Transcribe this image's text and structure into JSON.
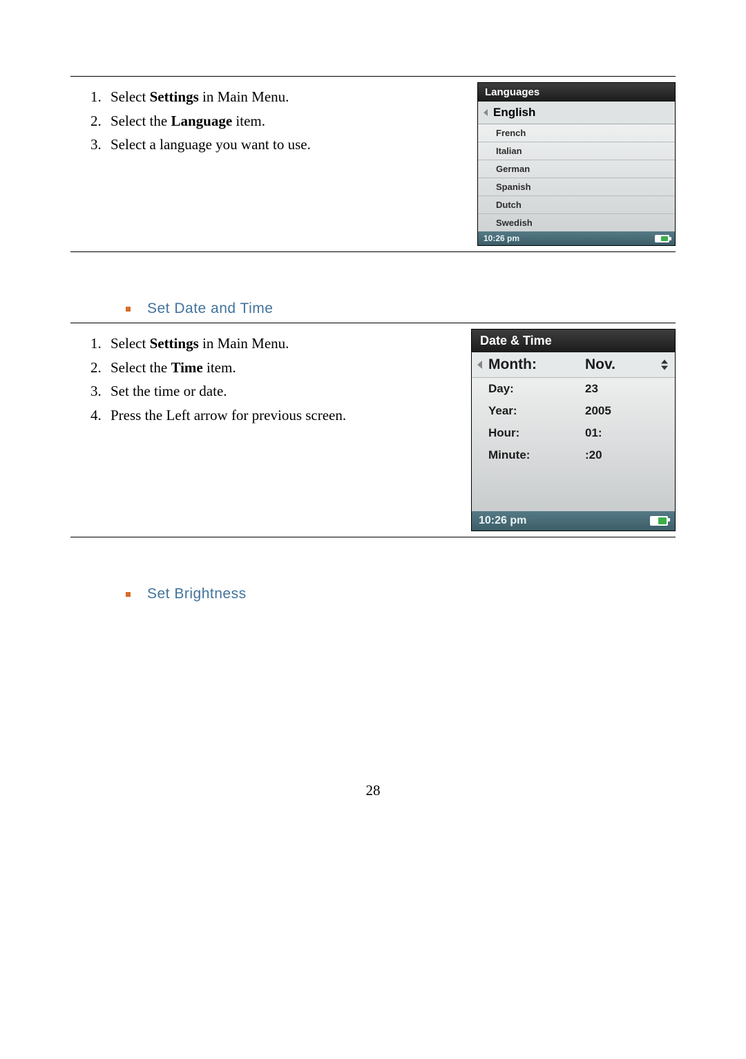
{
  "section1": {
    "steps": [
      {
        "pre": "Select ",
        "bold": "Settings",
        "post": " in Main Menu."
      },
      {
        "pre": "Select the ",
        "bold": "Language",
        "post": " item."
      },
      {
        "pre": "Select a language you want to use.",
        "bold": "",
        "post": ""
      }
    ],
    "device": {
      "title": "Languages",
      "selected": "English",
      "items": [
        "French",
        "Italian",
        "German",
        "Spanish",
        "Dutch",
        "Swedish"
      ],
      "status_time": "10:26 pm"
    }
  },
  "heading_datetime": "Set Date and Time",
  "section2": {
    "steps": [
      {
        "pre": "Select ",
        "bold": "Settings",
        "post": " in Main Menu."
      },
      {
        "pre": "Select the ",
        "bold": "Time",
        "post": " item."
      },
      {
        "pre": "Set the time or date.",
        "bold": "",
        "post": ""
      },
      {
        "pre": "Press the Left arrow for previous screen.",
        "bold": "",
        "post": ""
      }
    ],
    "device": {
      "title": "Date & Time",
      "rows": [
        {
          "label": "Month:",
          "value": "Nov.",
          "selected": true
        },
        {
          "label": "Day:",
          "value": "23"
        },
        {
          "label": "Year:",
          "value": "2005"
        },
        {
          "label": "Hour:",
          "value": "01:"
        },
        {
          "label": "Minute:",
          "value": ":20"
        }
      ],
      "status_time": "10:26 pm"
    }
  },
  "heading_brightness": "Set Brightness",
  "page_number": "28"
}
